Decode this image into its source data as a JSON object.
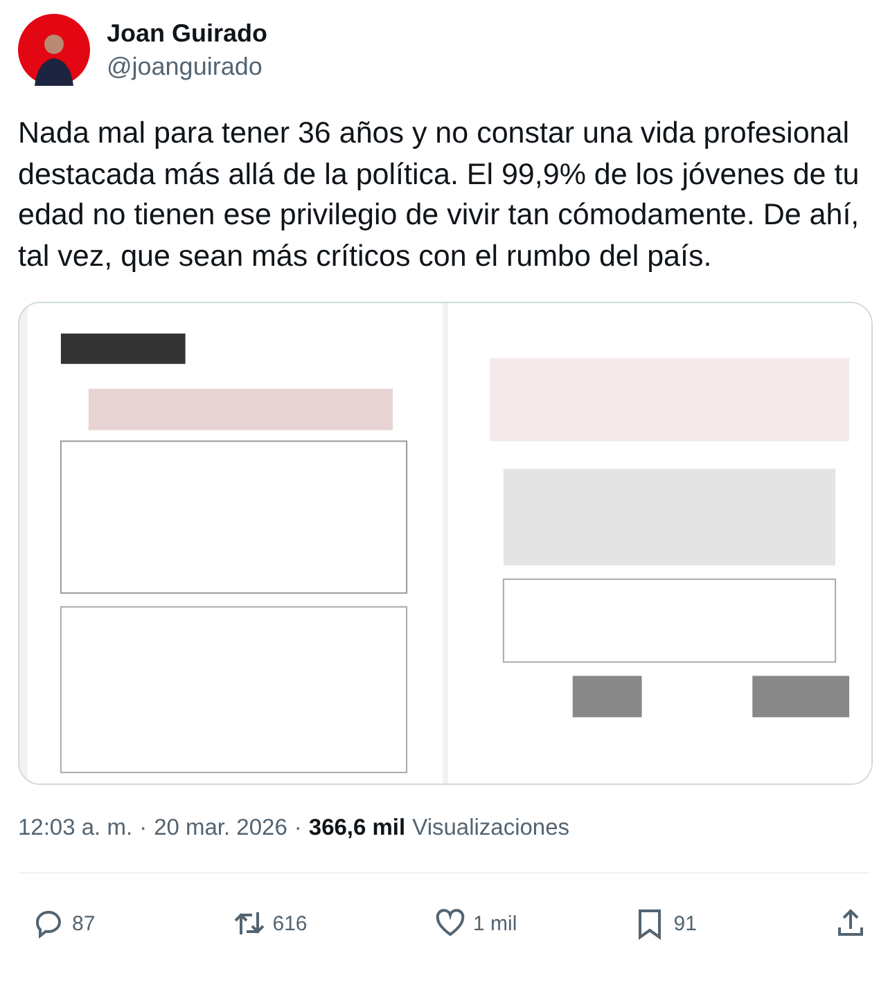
{
  "author": {
    "name": "Joan Guirado",
    "handle": "@joanguirado"
  },
  "text": "Nada mal para tener 36 años y no constar una vida profesional destacada más allá de la política. El 99,9% de los jóvenes de tu edad no tienen ese privilegio de vivir tan cómodamente. De ahí, tal vez, que sean más críticos con el rumbo del país.",
  "meta": {
    "time": "12:03 a. m.",
    "sep1": "·",
    "date": "20 mar. 2026",
    "sep2": "·",
    "views": "366,6 mil",
    "views_label": "Visualizaciones"
  },
  "actions": [
    {
      "kind": "reply",
      "count": "87"
    },
    {
      "kind": "repost",
      "count": "616"
    },
    {
      "kind": "like",
      "count": "1 mil"
    },
    {
      "kind": "bookmark",
      "count": "91"
    },
    {
      "kind": "share"
    }
  ]
}
